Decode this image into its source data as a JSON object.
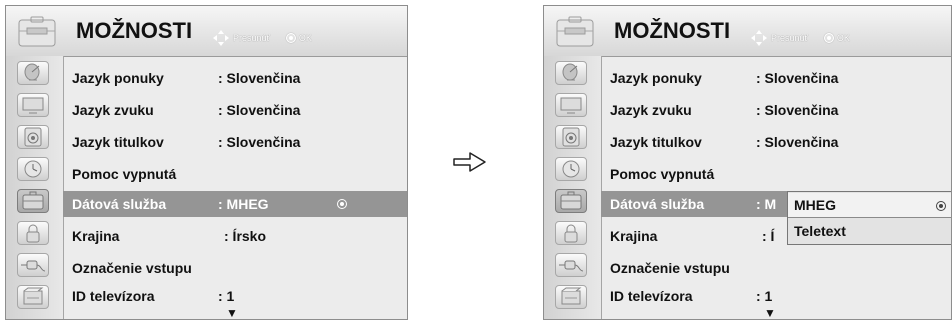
{
  "menu": {
    "title": "MOŽNOSTI",
    "hint_move": "Presunúť",
    "hint_ok": "OK",
    "items": [
      {
        "label": "Jazyk ponuky",
        "value": ": Slovenčina"
      },
      {
        "label": "Jazyk zvuku",
        "value": ": Slovenčina"
      },
      {
        "label": "Jazyk titulkov",
        "value": ": Slovenčina"
      },
      {
        "label": "Pomoc vypnutá",
        "value": ""
      },
      {
        "label": "Dátová služba",
        "value": ": MHEG"
      },
      {
        "label": "Krajina",
        "value": ": Írsko"
      },
      {
        "label": "Označenie vstupu",
        "value": ""
      },
      {
        "label": "ID televízora",
        "value": ": 1"
      }
    ],
    "more_indicator": "▼"
  },
  "right_panel": {
    "selected_value_partial": ": M",
    "country_partial": ": Í"
  },
  "dropdown": {
    "options": [
      "MHEG",
      "Teletext"
    ],
    "selected": "MHEG"
  },
  "sidebar_icons": [
    "satellite-dish-icon",
    "monitor-icon",
    "speaker-icon",
    "clock-icon",
    "options-toolbox-icon",
    "lock-icon",
    "input-plug-icon",
    "usb-media-icon"
  ],
  "colors": {
    "highlight": "#959595",
    "panel": "#ececec"
  }
}
